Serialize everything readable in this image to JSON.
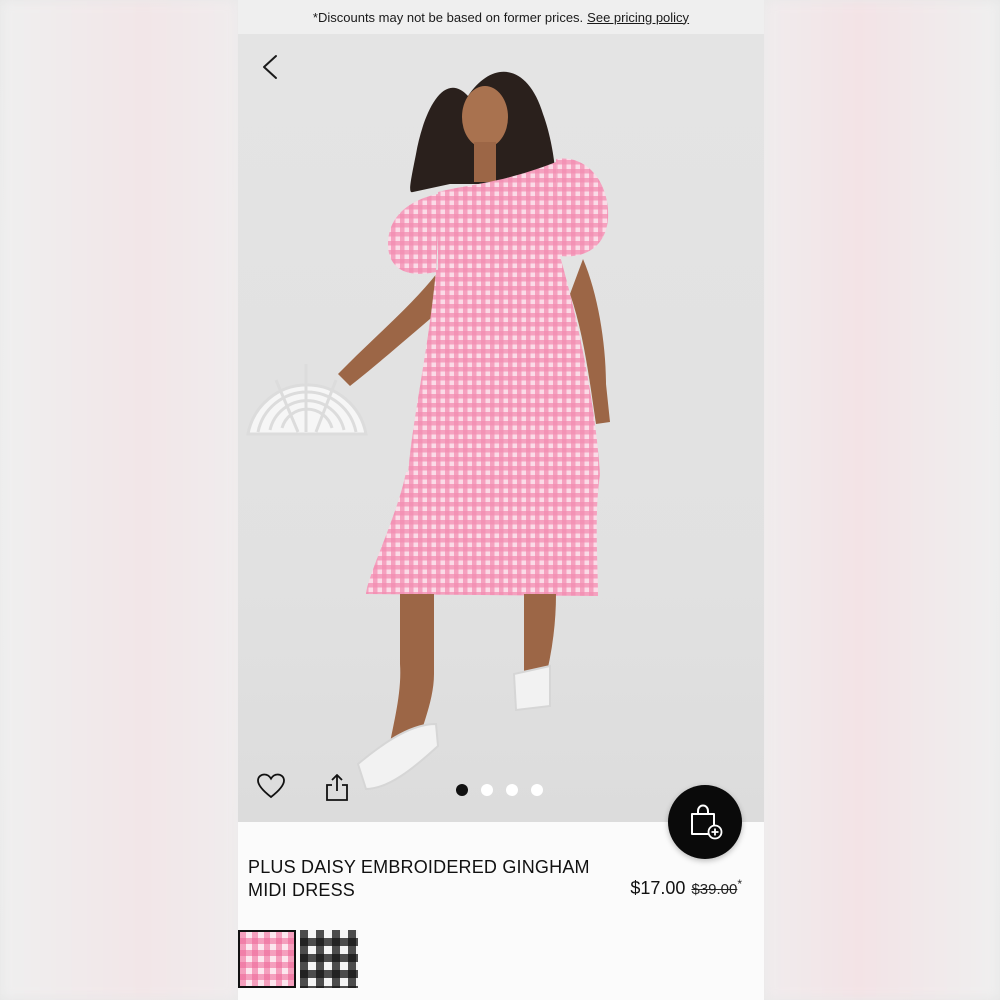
{
  "banner": {
    "text": "*Discounts may not be based on former prices.",
    "link": "See pricing policy"
  },
  "gallery": {
    "image_alt": "Model wearing pink gingham midi dress",
    "pages": 4,
    "active_page": 1
  },
  "product": {
    "title_line1": "PLUS DAISY EMBROIDERED GINGHAM",
    "title_line2": "MIDI DRESS",
    "price": "$17.00",
    "was_price": "$39.00",
    "was_marker": "*"
  },
  "swatches": [
    {
      "name": "pink gingham",
      "selected": true
    },
    {
      "name": "black gingham",
      "selected": false
    }
  ],
  "colors": {
    "dress_pink": "#f27aa4",
    "accent_black": "#0a0a0a",
    "page_bg": "#e3e3e3"
  },
  "icons": [
    "back-arrow-icon",
    "heart-icon",
    "share-icon",
    "shopping-bag-add-icon"
  ]
}
